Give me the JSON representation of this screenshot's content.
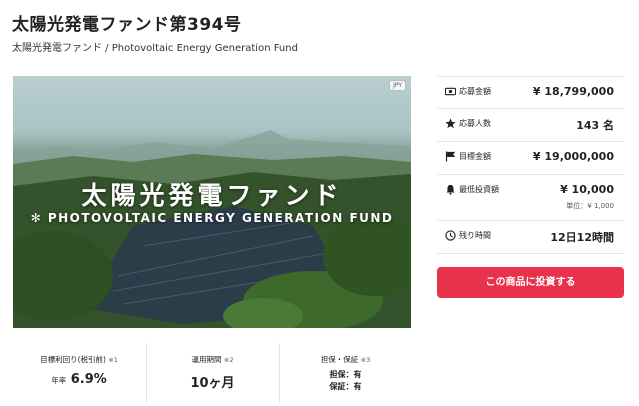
{
  "header": {
    "title": "太陽光発電ファンド第394号",
    "subtitle": "太陽光発電ファンド / Photovoltaic Energy Generation Fund"
  },
  "hero": {
    "title_jp": "太陽光発電ファンド",
    "title_en": "✻ PHOTOVOLTAIC ENERGY GENERATION FUND",
    "badge": "JPY"
  },
  "summary": {
    "rows": [
      {
        "icon": "money-icon",
        "label": "応募金額",
        "value": "¥ 18,799,000"
      },
      {
        "icon": "star-icon",
        "label": "応募人数",
        "value": "143 名"
      },
      {
        "icon": "flag-icon",
        "label": "目標金額",
        "value": "¥ 19,000,000"
      },
      {
        "icon": "bell-icon",
        "label": "最低投資額",
        "value": "¥ 10,000",
        "sub": "単位：¥ 1,000"
      },
      {
        "icon": "clock-icon",
        "label": "残り時間",
        "value": "12日12時間"
      }
    ],
    "invest_button": "この商品に投資する"
  },
  "stats": {
    "yield": {
      "label": "目標利回り(税引前)",
      "note": "※1",
      "prefix": "年率",
      "value": "6.9%"
    },
    "period": {
      "label": "運用期間",
      "note": "※2",
      "value": "10ヶ月"
    },
    "security": {
      "label": "担保・保証",
      "note": "※3",
      "line1": "担保：有",
      "line2": "保証：有"
    }
  },
  "colors": {
    "accent": "#e8314a"
  }
}
